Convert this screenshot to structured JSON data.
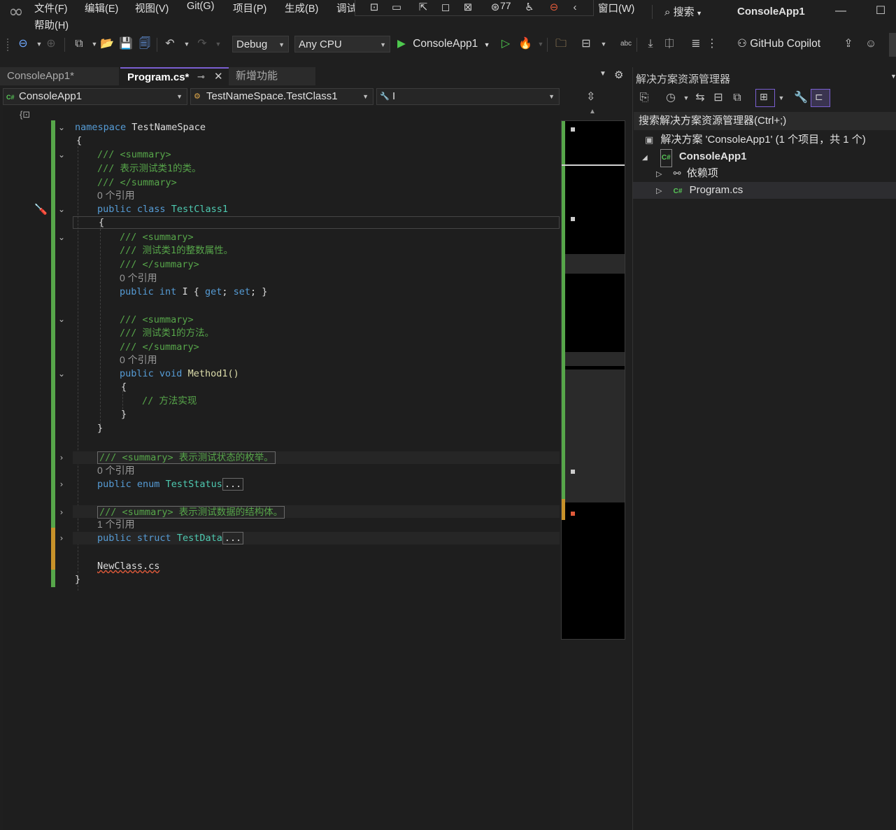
{
  "menubar": {
    "items": [
      "文件(F)",
      "编辑(E)",
      "视图(V)",
      "Git(G)",
      "项目(P)",
      "生成(B)",
      "调试"
    ],
    "window_menu": "窗口(W)",
    "help_menu": "帮助(H)",
    "search_label": "搜索",
    "window_title": "ConsoleApp1",
    "notification_count": "77"
  },
  "toolbar": {
    "configuration": "Debug",
    "platform": "Any CPU",
    "run_target": "ConsoleApp1",
    "copilot_label": "GitHub Copilot"
  },
  "tabs": {
    "project_tab": "ConsoleApp1*",
    "program_tab": "Program.cs*",
    "new_features_tab": "新增功能"
  },
  "navbar": {
    "project": "ConsoleApp1",
    "type": "TestNameSpace.TestClass1",
    "member": "I"
  },
  "code": {
    "namespace_kw": "namespace",
    "namespace_name": "TestNameSpace",
    "brace_open": "{",
    "brace_close": "}",
    "c1": "/// <summary>",
    "c2": "/// 表示测试类1的类。",
    "c3": "/// </summary>",
    "ref0": "0 个引用",
    "ref1": "1 个引用",
    "class_public": "public",
    "class_kw": "class",
    "class_name": "TestClass1",
    "p1": "/// <summary>",
    "p2": "/// 测试类1的整数属性。",
    "p3": "/// </summary>",
    "prop_public": "public",
    "prop_int": "int",
    "prop_rest": "I { ",
    "prop_get": "get",
    "prop_mid": "; ",
    "prop_set": "set",
    "prop_end": "; }",
    "m1": "/// <summary>",
    "m2": "/// 测试类1的方法。",
    "m3": "/// </summary>",
    "method_public": "public",
    "method_void": "void",
    "method_name": "Method1()",
    "method_comment": "// 方法实现",
    "enum_summary": "/// <summary> 表示测试状态的枚举。",
    "enum_public": "public",
    "enum_kw": "enum",
    "enum_name": "TestStatus",
    "ellipsis": "...",
    "struct_summary": "/// <summary> 表示测试数据的结构体。",
    "struct_public": "public",
    "struct_kw": "struct",
    "struct_name": "TestData",
    "newclass": "NewClass.cs"
  },
  "solution_explorer": {
    "title": "解决方案资源管理器",
    "search_placeholder": "搜索解决方案资源管理器(Ctrl+;)",
    "solution_label": "解决方案 'ConsoleApp1' (1 个项目，共 1 个)",
    "project_label": "ConsoleApp1",
    "dependencies_label": "依赖项",
    "file_label": "Program.cs",
    "cs_badge": "C#"
  },
  "colors": {
    "keyword": "#569cd6",
    "comment": "#57a64a",
    "type": "#4ec9b0",
    "change_bar": "#57a64a",
    "accent": "#7a5fd1"
  }
}
